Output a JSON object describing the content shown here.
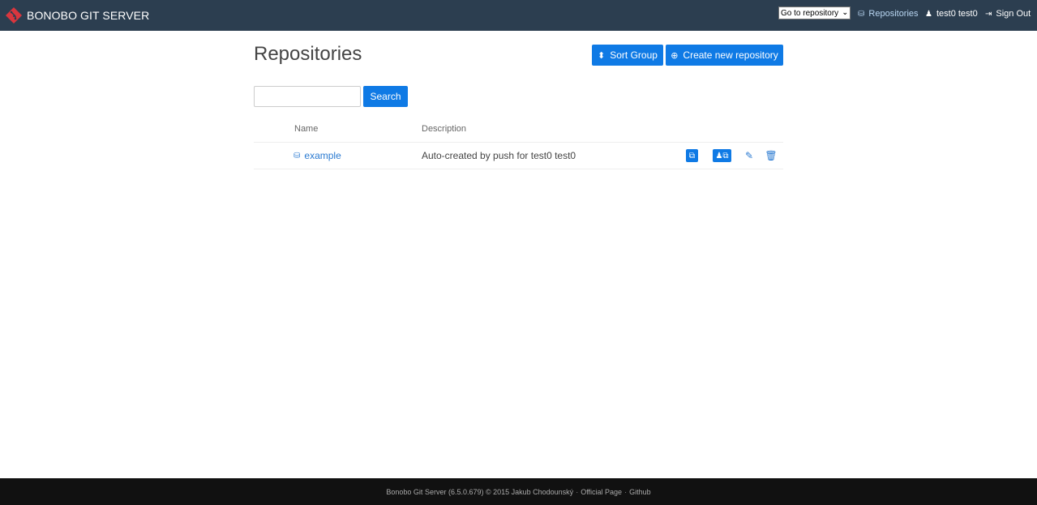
{
  "app": {
    "brand": "BONOBO GIT SERVER",
    "accent_color": "#0f7ae5",
    "topbar_color": "#2c3e50"
  },
  "topnav": {
    "goto_select": "Go to repository",
    "repositories_label": "Repositories",
    "repositories_icon": "hdd-icon",
    "user_label": "test0 test0",
    "user_icon": "user-icon",
    "signout_label": "Sign Out",
    "signout_icon": "logout-icon"
  },
  "page": {
    "title": "Repositories",
    "sort_group_label": "Sort Group",
    "create_repo_label": "Create new repository"
  },
  "search": {
    "value": "",
    "placeholder": "",
    "button_label": "Search"
  },
  "table": {
    "columns": [
      "Name",
      "Description"
    ],
    "rows": [
      {
        "name": "example",
        "description": "Auto-created by push for test0 test0",
        "actions": [
          "clone-icon",
          "user-clone-icon",
          "edit-icon",
          "delete-icon"
        ]
      }
    ]
  },
  "footer": {
    "text": "Bonobo Git Server (6.5.0.679) © 2015 Jakub Chodounský",
    "link_official": "Official Page",
    "link_github": "Github",
    "separator": "·"
  }
}
